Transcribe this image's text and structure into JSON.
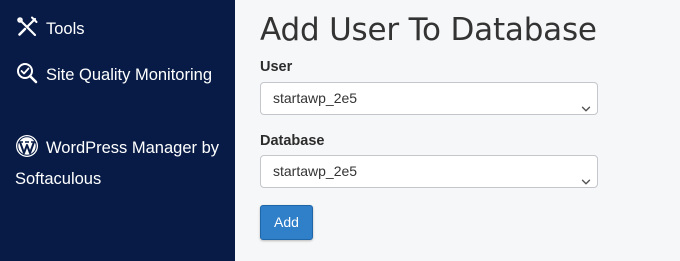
{
  "sidebar": {
    "items": [
      {
        "label": "Tools",
        "icon": "tools-icon"
      },
      {
        "label": "Site Quality Monitoring",
        "icon": "site-quality-icon"
      },
      {
        "label": "WordPress Manager by Softaculous",
        "icon": "wordpress-icon"
      }
    ],
    "background_color": "#071b46"
  },
  "main": {
    "title": "Add User To Database",
    "user": {
      "label": "User",
      "selected": "startawp_2e5"
    },
    "database": {
      "label": "Database",
      "selected": "startawp_2e5"
    },
    "add_button_label": "Add",
    "button_color": "#2f7fc9"
  }
}
